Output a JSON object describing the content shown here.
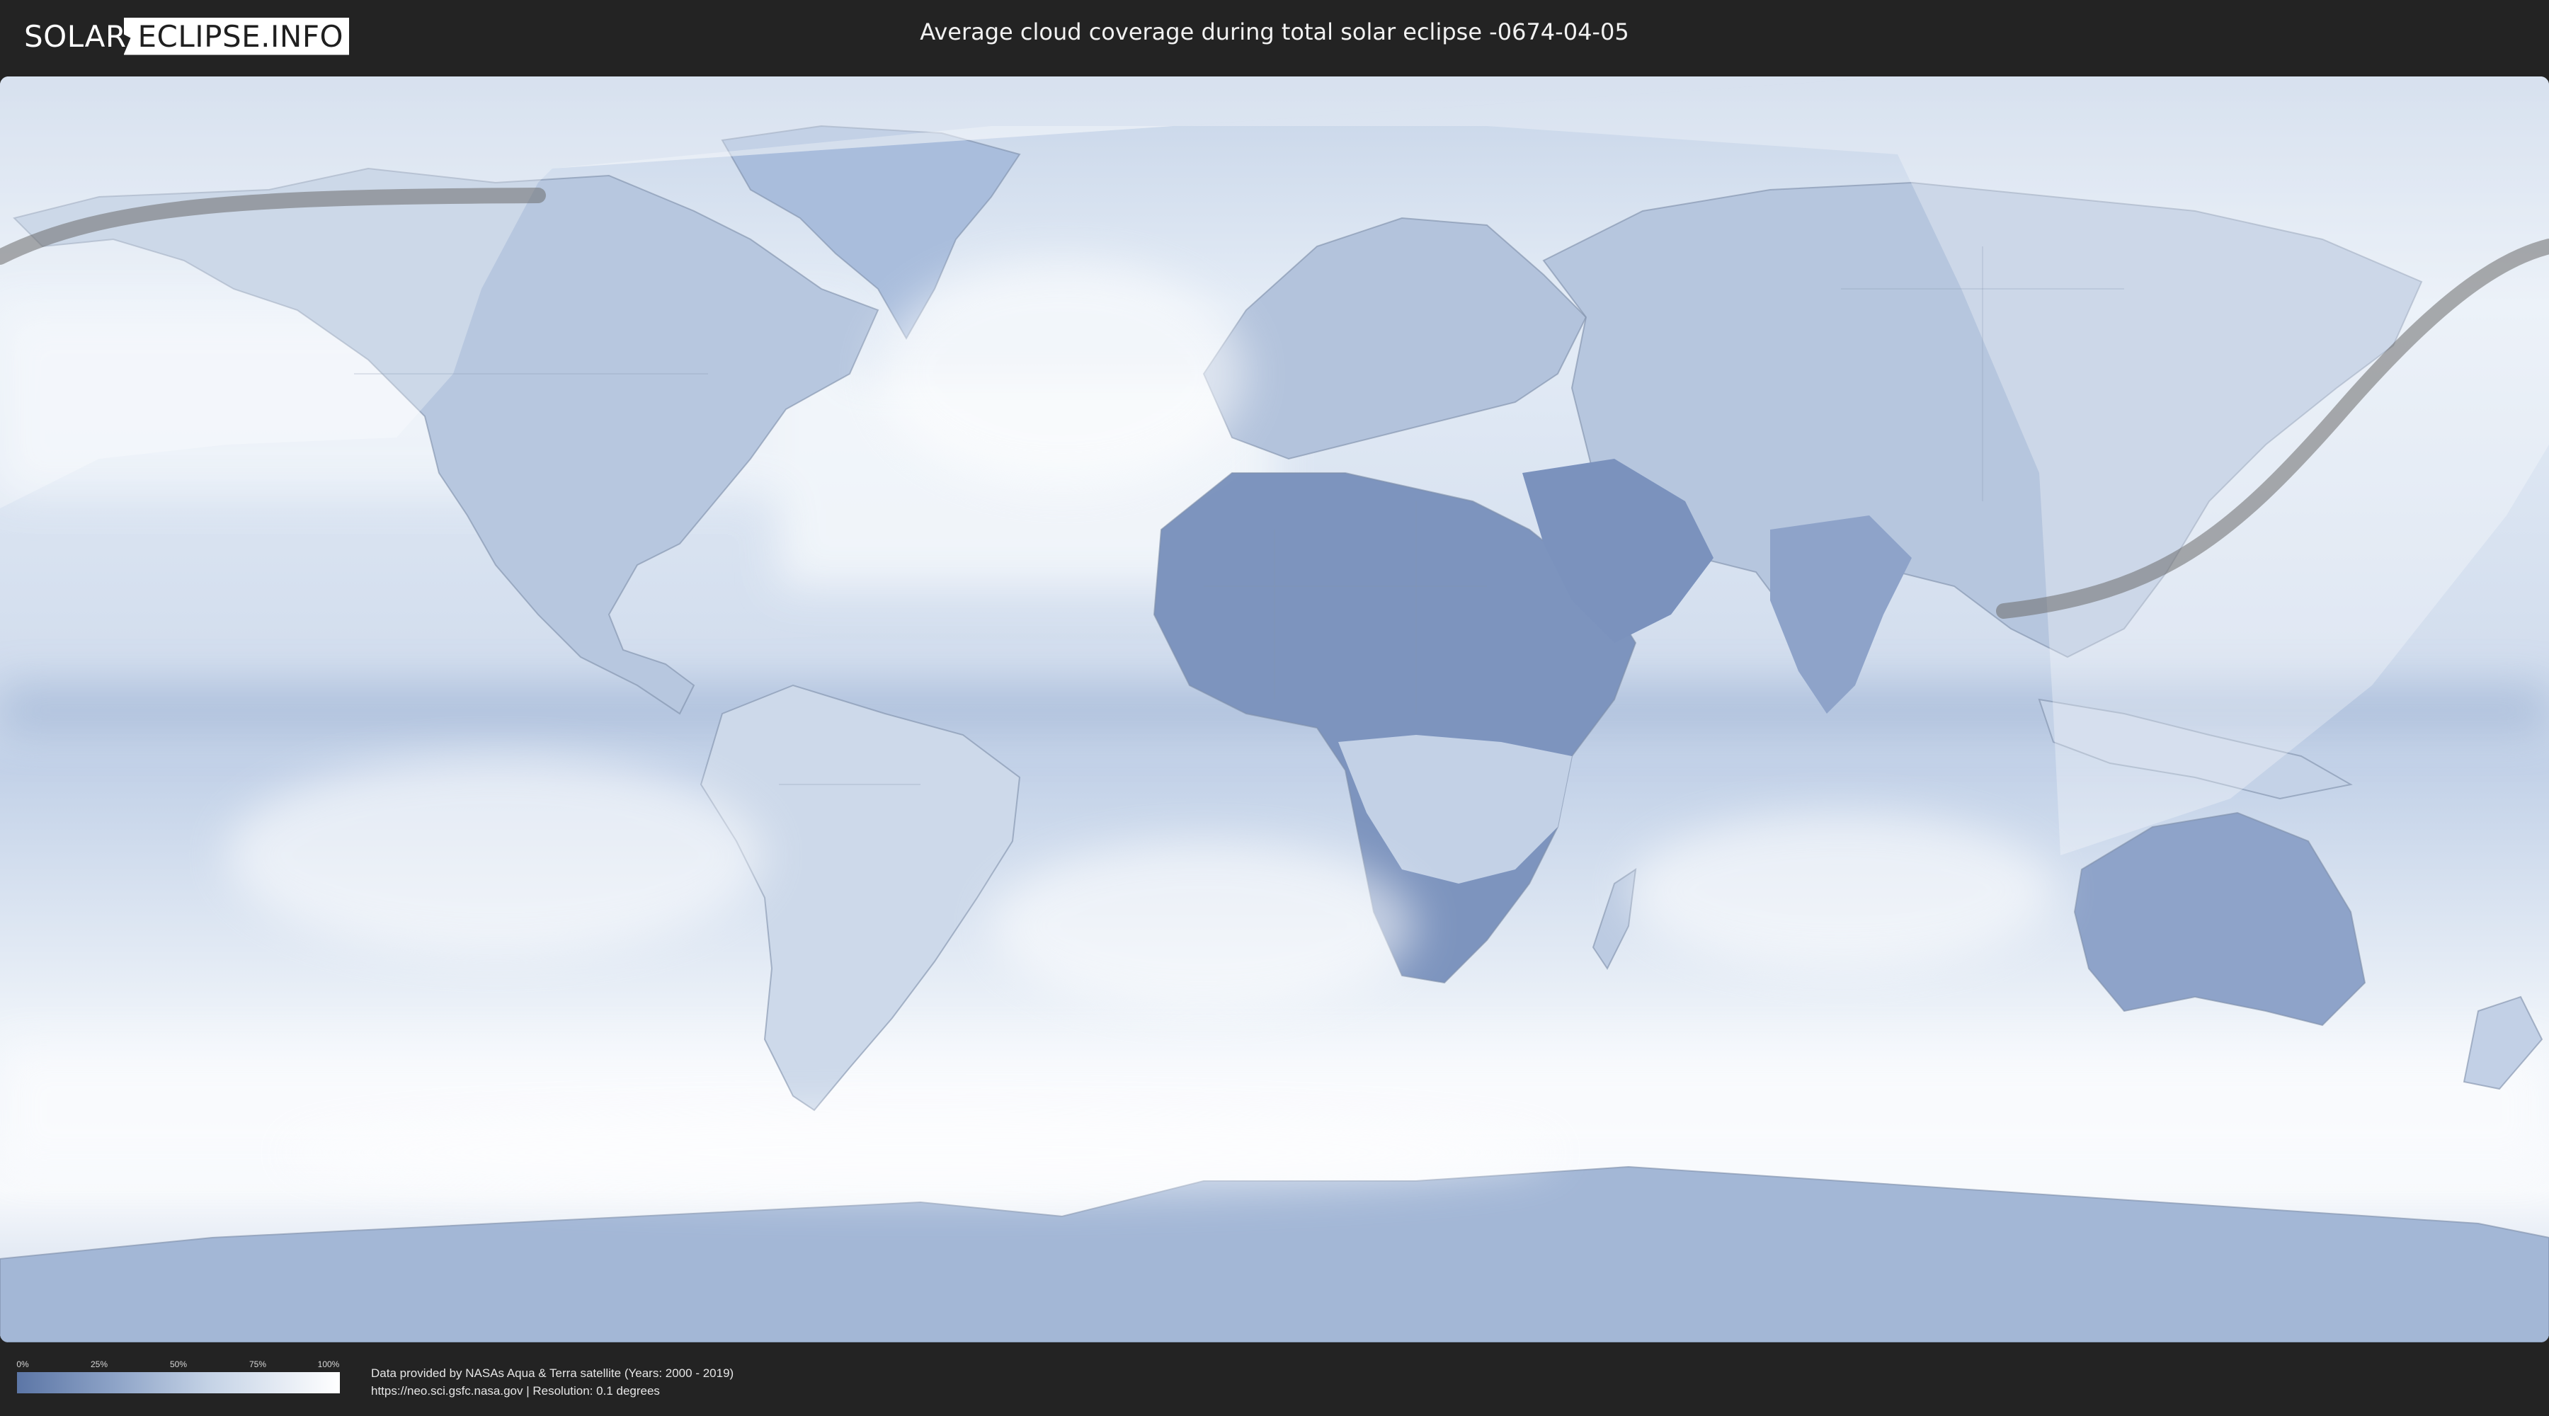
{
  "header": {
    "logo_part1": "SOLAR",
    "logo_part2": "ECLIPSE.INFO",
    "title": "Average cloud coverage during total solar eclipse -0674-04-05"
  },
  "legend": {
    "ticks": [
      "0%",
      "25%",
      "50%",
      "75%",
      "100%"
    ],
    "colors": {
      "low": "#5c76a6",
      "high": "#ffffff"
    }
  },
  "credits": {
    "line1": "Data provided by NASAs Aqua & Terra satellite (Years: 2000 - 2019)",
    "line2": "https://neo.sci.gsfc.nasa.gov | Resolution: 0.1 degrees"
  },
  "map": {
    "ocean_color": "#dfe8f3",
    "land_color": "#a7b9d6",
    "dry_land_color": "#6f86b3",
    "visibility_overlay": "#ffffff",
    "eclipse_path_color": "#6b6b6b"
  }
}
